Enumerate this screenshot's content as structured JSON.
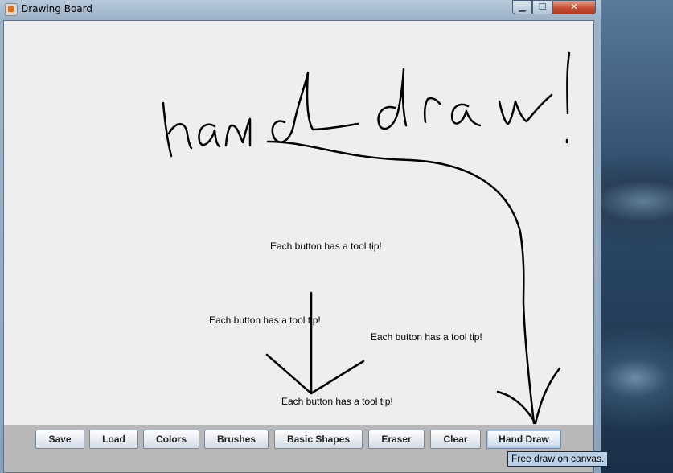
{
  "window": {
    "title": "Drawing Board",
    "controls": {
      "minimize": "▁",
      "maximize": "☐",
      "close": "✕"
    }
  },
  "canvas": {
    "texts": [
      "Each button has a tool tip!",
      "Each button has a tool tip!",
      "Each button has a tool tip!",
      "Each button has a tool tip!"
    ],
    "handwriting": "hand draw!"
  },
  "toolbar": {
    "buttons": [
      {
        "label": "Save"
      },
      {
        "label": "Load"
      },
      {
        "label": "Colors"
      },
      {
        "label": "Brushes"
      },
      {
        "label": "Basic Shapes"
      },
      {
        "label": "Eraser"
      },
      {
        "label": "Clear"
      },
      {
        "label": "Hand Draw"
      }
    ],
    "active": "Hand Draw"
  },
  "tooltip": {
    "text": "Free draw on canvas."
  },
  "colors": {
    "stroke": "#000000",
    "canvas_bg": "#eeeeee",
    "toolbar_bg": "#b8b8b8",
    "tooltip_bg": "#b8cfe5"
  }
}
